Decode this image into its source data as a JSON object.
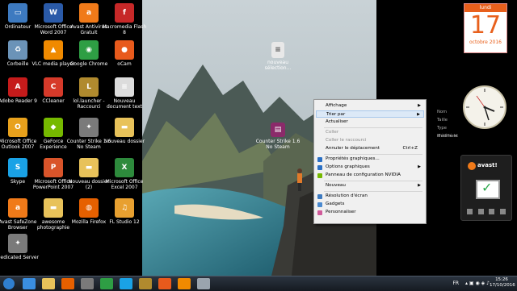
{
  "desktop_icons": [
    {
      "label": "Ordinateur",
      "icon": "computer-icon",
      "color": "#3d7ac0"
    },
    {
      "label": "Microsoft Office Word 2007",
      "icon": "word-icon",
      "color": "#2a5aa8"
    },
    {
      "label": "Avast Antivirus Gratuit",
      "icon": "avast-icon",
      "color": "#f07a19"
    },
    {
      "label": "Macromedia Flash 8",
      "icon": "flash-icon",
      "color": "#c62828"
    },
    {
      "label": "Corbeille",
      "icon": "recycle-bin-icon",
      "color": "#6b93b8"
    },
    {
      "label": "VLC media player",
      "icon": "vlc-icon",
      "color": "#f08a00"
    },
    {
      "label": "Google Chrome",
      "icon": "chrome-icon",
      "color": "#2e9e44"
    },
    {
      "label": "oCam",
      "icon": "ocam-icon",
      "color": "#e85a1c"
    },
    {
      "label": "Adobe Reader 9",
      "icon": "adobe-reader-icon",
      "color": "#c51b1b"
    },
    {
      "label": "CCleaner",
      "icon": "ccleaner-icon",
      "color": "#d63a2a"
    },
    {
      "label": "lol.launcher - Raccourci",
      "icon": "lol-icon",
      "color": "#b08a2e"
    },
    {
      "label": "Nouveau document text",
      "icon": "text-document-icon",
      "color": "#dcdcdc"
    },
    {
      "label": "Microsoft Office Outlook 2007",
      "icon": "outlook-icon",
      "color": "#e8a11c"
    },
    {
      "label": "GeForce Experience",
      "icon": "geforce-icon",
      "color": "#76b900"
    },
    {
      "label": "Counter Strike 1.6 No Steam",
      "icon": "counter-strike-icon",
      "color": "#7a7a7a"
    },
    {
      "label": "Nouveau dossier",
      "icon": "folder-icon",
      "color": "#e8c25a"
    },
    {
      "label": "Skype",
      "icon": "skype-icon",
      "color": "#1aa2e6"
    },
    {
      "label": "Microsoft Office PowerPoint 2007",
      "icon": "powerpoint-icon",
      "color": "#d9542a"
    },
    {
      "label": "Nouveau dossier (2)",
      "icon": "folder-icon",
      "color": "#e8c25a"
    },
    {
      "label": "Microsoft Office Excel 2007",
      "icon": "excel-icon",
      "color": "#2d8a3c"
    },
    {
      "label": "Avast SafeZone Browser",
      "icon": "avast-safezone-icon",
      "color": "#f07a19"
    },
    {
      "label": "awesome photographie",
      "icon": "folder-icon",
      "color": "#e8c25a"
    },
    {
      "label": "Mozilla Firefox",
      "icon": "firefox-icon",
      "color": "#e66000"
    },
    {
      "label": "FL Studio 12",
      "icon": "fl-studio-icon",
      "color": "#e8a030"
    },
    {
      "label": "Dedicated Server",
      "icon": "counter-strike-icon",
      "color": "#7a7a7a"
    }
  ],
  "wallpaper_icons": [
    {
      "label": "nouveau sélection...",
      "icon": "text-document-icon"
    },
    {
      "label": "Counter Strike 1.6 No Steam",
      "icon": "winrar-archive-icon"
    }
  ],
  "context_menu": {
    "items": [
      {
        "label": "Affichage",
        "submenu": true,
        "shortcut": "",
        "disabled": false,
        "highlight": false,
        "icon": ""
      },
      {
        "label": "Trier par",
        "submenu": true,
        "shortcut": "",
        "disabled": false,
        "highlight": true,
        "icon": ""
      },
      {
        "label": "Actualiser",
        "submenu": false,
        "shortcut": "",
        "disabled": false,
        "highlight": false,
        "icon": ""
      },
      {
        "sep": true
      },
      {
        "label": "Coller",
        "submenu": false,
        "shortcut": "",
        "disabled": true,
        "highlight": false,
        "icon": ""
      },
      {
        "label": "Coller le raccourci",
        "submenu": false,
        "shortcut": "",
        "disabled": true,
        "highlight": false,
        "icon": ""
      },
      {
        "label": "Annuler le déplacement",
        "submenu": false,
        "shortcut": "Ctrl+Z",
        "disabled": false,
        "highlight": false,
        "icon": ""
      },
      {
        "sep": true
      },
      {
        "label": "Propriétés graphiques...",
        "submenu": false,
        "shortcut": "",
        "disabled": false,
        "highlight": false,
        "icon": "intel-graphics-icon"
      },
      {
        "label": "Options graphiques",
        "submenu": true,
        "shortcut": "",
        "disabled": false,
        "highlight": false,
        "icon": "intel-graphics-icon"
      },
      {
        "label": "Panneau de configuration NVIDIA",
        "submenu": false,
        "shortcut": "",
        "disabled": false,
        "highlight": false,
        "icon": "nvidia-icon"
      },
      {
        "sep": true
      },
      {
        "label": "Nouveau",
        "submenu": true,
        "shortcut": "",
        "disabled": false,
        "highlight": false,
        "icon": ""
      },
      {
        "sep": true
      },
      {
        "label": "Résolution d'écran",
        "submenu": false,
        "shortcut": "",
        "disabled": false,
        "highlight": false,
        "icon": "screen-resolution-icon"
      },
      {
        "label": "Gadgets",
        "submenu": false,
        "shortcut": "",
        "disabled": false,
        "highlight": false,
        "icon": "gadgets-icon"
      },
      {
        "label": "Personnaliser",
        "submenu": false,
        "shortcut": "",
        "disabled": false,
        "highlight": false,
        "icon": "personalize-icon"
      }
    ]
  },
  "submenu": {
    "items": [
      "Nom",
      "Taille",
      "Type d'élément",
      "Modifié le"
    ]
  },
  "calendar_gadget": {
    "weekday": "lundi",
    "day": "17",
    "month": "octobre 2016"
  },
  "avast_gadget": {
    "brand": "avast!"
  },
  "taskbar": {
    "pinned": [
      {
        "icon": "start-orb-icon"
      },
      {
        "icon": "ie-icon"
      },
      {
        "icon": "explorer-icon"
      },
      {
        "icon": "firefox-icon"
      },
      {
        "icon": "counter-strike-icon"
      },
      {
        "icon": "chrome-icon"
      },
      {
        "icon": "skype-icon"
      },
      {
        "icon": "lol-icon"
      },
      {
        "icon": "ocam-icon"
      },
      {
        "icon": "vlc-icon"
      },
      {
        "icon": "recorder-icon"
      }
    ],
    "language": "FR",
    "time": "15:26",
    "date": "17/10/2016"
  },
  "colors": {
    "menu_bg": "#f0f0f0",
    "menu_highlight": "#dce9f7",
    "calendar_accent": "#e8601c",
    "taskbar": "#1c232c"
  }
}
